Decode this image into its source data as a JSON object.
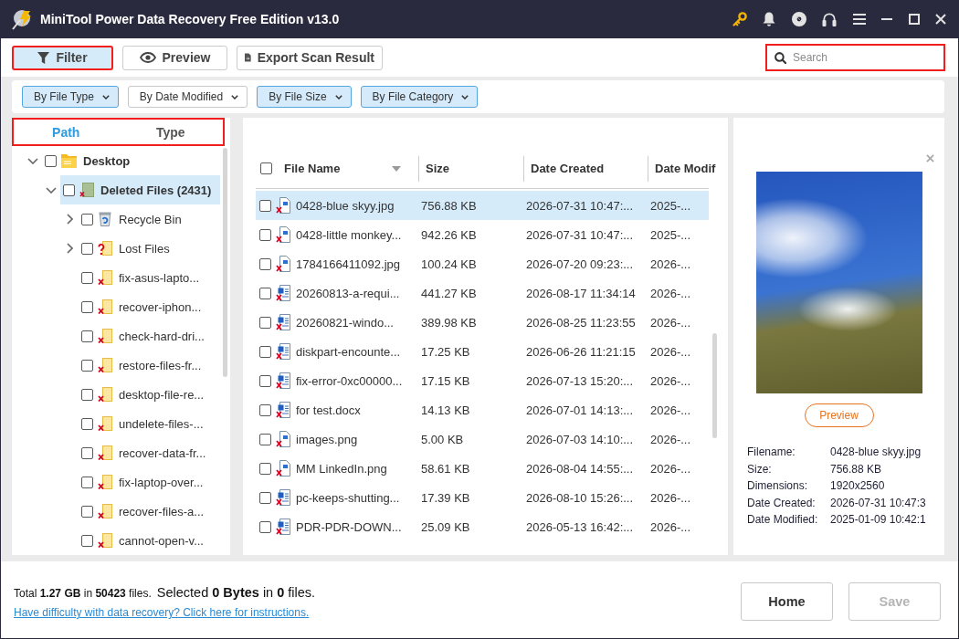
{
  "window": {
    "title": "MiniTool Power Data Recovery Free Edition v13.0"
  },
  "toolbar": {
    "buttons": [
      {
        "kind": "filter",
        "label": "Filter",
        "selected": true,
        "highlighted": true
      },
      {
        "kind": "preview",
        "label": "Preview",
        "selected": false,
        "highlighted": false
      },
      {
        "kind": "export",
        "label": "Export Scan Result",
        "selected": false,
        "highlighted": false
      }
    ],
    "search": {
      "placeholder": "Search",
      "highlighted": true
    }
  },
  "filters": [
    {
      "label": "By File Type",
      "active": true
    },
    {
      "label": "By Date Modified",
      "active": false
    },
    {
      "label": "By File Size",
      "active": true
    },
    {
      "label": "By File Category",
      "active": true
    }
  ],
  "sidebar": {
    "highlighted": true,
    "tabs": [
      {
        "label": "Path",
        "selected": true
      },
      {
        "label": "Type",
        "selected": false
      }
    ],
    "tree": [
      {
        "label": "Desktop",
        "kind": "folder",
        "checked": false,
        "selected": false,
        "expanded": true,
        "children": [
          {
            "label": "Deleted Files (2431)",
            "kind": "deleted-root",
            "checked": false,
            "selected": true,
            "expanded": true,
            "children": [
              {
                "label": "Recycle Bin",
                "kind": "recycle-bin",
                "checked": false,
                "selected": false,
                "expanded": false
              },
              {
                "label": "Lost Files",
                "kind": "lost",
                "checked": false,
                "selected": false,
                "expanded": false
              },
              {
                "label": "fix-asus-lapto...",
                "kind": "deleted",
                "checked": false,
                "selected": false
              },
              {
                "label": "recover-iphon...",
                "kind": "deleted",
                "checked": false,
                "selected": false
              },
              {
                "label": "check-hard-dri...",
                "kind": "deleted",
                "checked": false,
                "selected": false
              },
              {
                "label": "restore-files-fr...",
                "kind": "deleted",
                "checked": false,
                "selected": false
              },
              {
                "label": "desktop-file-re...",
                "kind": "deleted",
                "checked": false,
                "selected": false
              },
              {
                "label": "undelete-files-...",
                "kind": "deleted",
                "checked": false,
                "selected": false
              },
              {
                "label": "recover-data-fr...",
                "kind": "deleted",
                "checked": false,
                "selected": false
              },
              {
                "label": "fix-laptop-over...",
                "kind": "deleted",
                "checked": false,
                "selected": false
              },
              {
                "label": "recover-files-a...",
                "kind": "deleted",
                "checked": false,
                "selected": false
              },
              {
                "label": "cannot-open-v...",
                "kind": "deleted",
                "checked": false,
                "selected": false
              }
            ]
          }
        ]
      }
    ]
  },
  "table": {
    "all_checked": false,
    "columns": [
      {
        "label": "File Name",
        "sorted": true
      },
      {
        "label": "Size",
        "sorted": false
      },
      {
        "label": "Date Created",
        "sorted": false
      },
      {
        "label": "Date Modif",
        "sorted": false
      }
    ],
    "rows": [
      {
        "kind": "image",
        "name": "0428-blue skyy.jpg",
        "size": "756.88 KB",
        "created": "2026-07-31 10:47:...",
        "modified": "2025-...",
        "checked": false,
        "selected": true
      },
      {
        "kind": "image",
        "name": "0428-little monkey...",
        "size": "942.26 KB",
        "created": "2026-07-31 10:47:...",
        "modified": "2025-...",
        "checked": false,
        "selected": false
      },
      {
        "kind": "image",
        "name": "1784166411092.jpg",
        "size": "100.24 KB",
        "created": "2026-07-20 09:23:...",
        "modified": "2026-...",
        "checked": false,
        "selected": false
      },
      {
        "kind": "document",
        "name": "20260813-a-requi...",
        "size": "441.27 KB",
        "created": "2026-08-17 11:34:14",
        "modified": "2026-...",
        "checked": false,
        "selected": false
      },
      {
        "kind": "document",
        "name": "20260821-windo...",
        "size": "389.98 KB",
        "created": "2026-08-25 11:23:55",
        "modified": "2026-...",
        "checked": false,
        "selected": false
      },
      {
        "kind": "document",
        "name": "diskpart-encounte...",
        "size": "17.25 KB",
        "created": "2026-06-26 11:21:15",
        "modified": "2026-...",
        "checked": false,
        "selected": false
      },
      {
        "kind": "document",
        "name": "fix-error-0xc00000...",
        "size": "17.15 KB",
        "created": "2026-07-13 15:20:...",
        "modified": "2026-...",
        "checked": false,
        "selected": false
      },
      {
        "kind": "document",
        "name": "for test.docx",
        "size": "14.13 KB",
        "created": "2026-07-01 14:13:...",
        "modified": "2026-...",
        "checked": false,
        "selected": false
      },
      {
        "kind": "image",
        "name": "images.png",
        "size": "5.00 KB",
        "created": "2026-07-03 14:10:...",
        "modified": "2026-...",
        "checked": false,
        "selected": false
      },
      {
        "kind": "image",
        "name": "MM LinkedIn.png",
        "size": "58.61 KB",
        "created": "2026-08-04 14:55:...",
        "modified": "2026-...",
        "checked": false,
        "selected": false
      },
      {
        "kind": "document",
        "name": "pc-keeps-shutting...",
        "size": "17.39 KB",
        "created": "2026-08-10 15:26:...",
        "modified": "2026-...",
        "checked": false,
        "selected": false
      },
      {
        "kind": "document",
        "name": "PDR-PDR-DOWN...",
        "size": "25.09 KB",
        "created": "2026-05-13 16:42:...",
        "modified": "2026-...",
        "checked": false,
        "selected": false
      }
    ]
  },
  "preview_panel": {
    "button": "Preview",
    "details": [
      {
        "label": "Filename:",
        "value": "0428-blue skyy.jpg"
      },
      {
        "label": "Size:",
        "value": "756.88 KB"
      },
      {
        "label": "Dimensions:",
        "value": "1920x2560"
      },
      {
        "label": "Date Created:",
        "value": "2026-07-31 10:47:3"
      },
      {
        "label": "Date Modified:",
        "value": "2025-01-09 10:42:1"
      }
    ]
  },
  "status_bar": {
    "summary": "Total **1.27 GB** in **50423** files.",
    "selection": "Selected **0 Bytes** in **0** files.",
    "help_link": "Have difficulty with data recovery? Click here for instructions.",
    "buttons": [
      {
        "label": "Home",
        "disabled": false
      },
      {
        "label": "Save",
        "disabled": true
      }
    ]
  }
}
